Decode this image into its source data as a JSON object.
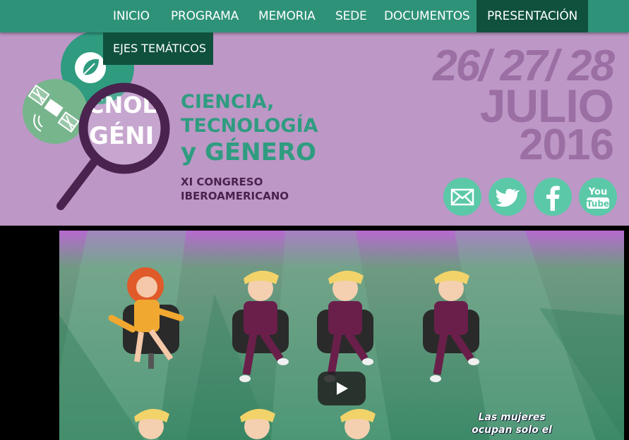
{
  "nav": {
    "items": [
      {
        "label": "INICIO"
      },
      {
        "label": "PROGRAMA"
      },
      {
        "label": "MEMORIA"
      },
      {
        "label": "SEDE"
      },
      {
        "label": "DOCUMENTOS"
      },
      {
        "label": "PRESENTACIÓN",
        "active": true
      }
    ],
    "dropdown": {
      "items": [
        {
          "label": "EJES TEMÁTICOS"
        }
      ]
    }
  },
  "banner": {
    "logo": {
      "fragment_top": "CNOL",
      "fragment_bottom": "GÉNI"
    },
    "title": {
      "line1": "CIENCIA,",
      "line2": "TECNOLOGÍA",
      "line3": "y GÉNERO"
    },
    "subtitle": {
      "line1": "XI CONGRESO",
      "line2": "IBEROAMERICANO"
    },
    "dates": {
      "days": "26/ 27/ 28",
      "month": "JULIO",
      "year": "2016"
    },
    "social": [
      {
        "icon": "mail-icon"
      },
      {
        "icon": "twitter-icon"
      },
      {
        "icon": "facebook-icon"
      },
      {
        "icon": "youtube-icon",
        "label_top": "You",
        "label_bottom": "Tube"
      }
    ]
  },
  "video": {
    "caption_line1": "Las mujeres",
    "caption_line2": "ocupan solo el"
  },
  "colors": {
    "nav": "#2e9278",
    "nav_active": "#0f513d",
    "banner": "#bd97c6",
    "title": "#2f9c80",
    "subtitle": "#4a234e",
    "dates": "#9b6fa3",
    "social": "#5bc8a8"
  }
}
